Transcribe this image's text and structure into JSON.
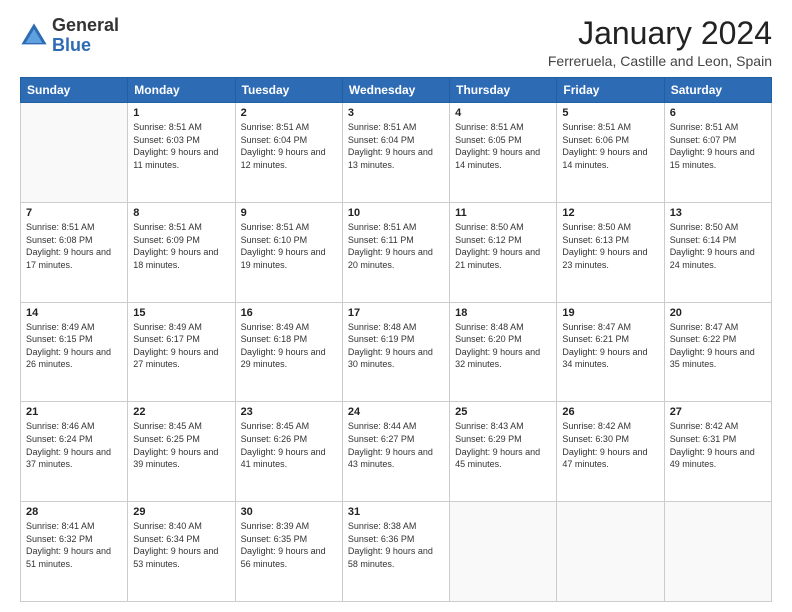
{
  "header": {
    "logo_general": "General",
    "logo_blue": "Blue",
    "month_year": "January 2024",
    "location": "Ferreruela, Castille and Leon, Spain"
  },
  "weekdays": [
    "Sunday",
    "Monday",
    "Tuesday",
    "Wednesday",
    "Thursday",
    "Friday",
    "Saturday"
  ],
  "weeks": [
    [
      {
        "day": "",
        "sunrise": "",
        "sunset": "",
        "daylight": ""
      },
      {
        "day": "1",
        "sunrise": "Sunrise: 8:51 AM",
        "sunset": "Sunset: 6:03 PM",
        "daylight": "Daylight: 9 hours and 11 minutes."
      },
      {
        "day": "2",
        "sunrise": "Sunrise: 8:51 AM",
        "sunset": "Sunset: 6:04 PM",
        "daylight": "Daylight: 9 hours and 12 minutes."
      },
      {
        "day": "3",
        "sunrise": "Sunrise: 8:51 AM",
        "sunset": "Sunset: 6:04 PM",
        "daylight": "Daylight: 9 hours and 13 minutes."
      },
      {
        "day": "4",
        "sunrise": "Sunrise: 8:51 AM",
        "sunset": "Sunset: 6:05 PM",
        "daylight": "Daylight: 9 hours and 14 minutes."
      },
      {
        "day": "5",
        "sunrise": "Sunrise: 8:51 AM",
        "sunset": "Sunset: 6:06 PM",
        "daylight": "Daylight: 9 hours and 14 minutes."
      },
      {
        "day": "6",
        "sunrise": "Sunrise: 8:51 AM",
        "sunset": "Sunset: 6:07 PM",
        "daylight": "Daylight: 9 hours and 15 minutes."
      }
    ],
    [
      {
        "day": "7",
        "sunrise": "Sunrise: 8:51 AM",
        "sunset": "Sunset: 6:08 PM",
        "daylight": "Daylight: 9 hours and 17 minutes."
      },
      {
        "day": "8",
        "sunrise": "Sunrise: 8:51 AM",
        "sunset": "Sunset: 6:09 PM",
        "daylight": "Daylight: 9 hours and 18 minutes."
      },
      {
        "day": "9",
        "sunrise": "Sunrise: 8:51 AM",
        "sunset": "Sunset: 6:10 PM",
        "daylight": "Daylight: 9 hours and 19 minutes."
      },
      {
        "day": "10",
        "sunrise": "Sunrise: 8:51 AM",
        "sunset": "Sunset: 6:11 PM",
        "daylight": "Daylight: 9 hours and 20 minutes."
      },
      {
        "day": "11",
        "sunrise": "Sunrise: 8:50 AM",
        "sunset": "Sunset: 6:12 PM",
        "daylight": "Daylight: 9 hours and 21 minutes."
      },
      {
        "day": "12",
        "sunrise": "Sunrise: 8:50 AM",
        "sunset": "Sunset: 6:13 PM",
        "daylight": "Daylight: 9 hours and 23 minutes."
      },
      {
        "day": "13",
        "sunrise": "Sunrise: 8:50 AM",
        "sunset": "Sunset: 6:14 PM",
        "daylight": "Daylight: 9 hours and 24 minutes."
      }
    ],
    [
      {
        "day": "14",
        "sunrise": "Sunrise: 8:49 AM",
        "sunset": "Sunset: 6:15 PM",
        "daylight": "Daylight: 9 hours and 26 minutes."
      },
      {
        "day": "15",
        "sunrise": "Sunrise: 8:49 AM",
        "sunset": "Sunset: 6:17 PM",
        "daylight": "Daylight: 9 hours and 27 minutes."
      },
      {
        "day": "16",
        "sunrise": "Sunrise: 8:49 AM",
        "sunset": "Sunset: 6:18 PM",
        "daylight": "Daylight: 9 hours and 29 minutes."
      },
      {
        "day": "17",
        "sunrise": "Sunrise: 8:48 AM",
        "sunset": "Sunset: 6:19 PM",
        "daylight": "Daylight: 9 hours and 30 minutes."
      },
      {
        "day": "18",
        "sunrise": "Sunrise: 8:48 AM",
        "sunset": "Sunset: 6:20 PM",
        "daylight": "Daylight: 9 hours and 32 minutes."
      },
      {
        "day": "19",
        "sunrise": "Sunrise: 8:47 AM",
        "sunset": "Sunset: 6:21 PM",
        "daylight": "Daylight: 9 hours and 34 minutes."
      },
      {
        "day": "20",
        "sunrise": "Sunrise: 8:47 AM",
        "sunset": "Sunset: 6:22 PM",
        "daylight": "Daylight: 9 hours and 35 minutes."
      }
    ],
    [
      {
        "day": "21",
        "sunrise": "Sunrise: 8:46 AM",
        "sunset": "Sunset: 6:24 PM",
        "daylight": "Daylight: 9 hours and 37 minutes."
      },
      {
        "day": "22",
        "sunrise": "Sunrise: 8:45 AM",
        "sunset": "Sunset: 6:25 PM",
        "daylight": "Daylight: 9 hours and 39 minutes."
      },
      {
        "day": "23",
        "sunrise": "Sunrise: 8:45 AM",
        "sunset": "Sunset: 6:26 PM",
        "daylight": "Daylight: 9 hours and 41 minutes."
      },
      {
        "day": "24",
        "sunrise": "Sunrise: 8:44 AM",
        "sunset": "Sunset: 6:27 PM",
        "daylight": "Daylight: 9 hours and 43 minutes."
      },
      {
        "day": "25",
        "sunrise": "Sunrise: 8:43 AM",
        "sunset": "Sunset: 6:29 PM",
        "daylight": "Daylight: 9 hours and 45 minutes."
      },
      {
        "day": "26",
        "sunrise": "Sunrise: 8:42 AM",
        "sunset": "Sunset: 6:30 PM",
        "daylight": "Daylight: 9 hours and 47 minutes."
      },
      {
        "day": "27",
        "sunrise": "Sunrise: 8:42 AM",
        "sunset": "Sunset: 6:31 PM",
        "daylight": "Daylight: 9 hours and 49 minutes."
      }
    ],
    [
      {
        "day": "28",
        "sunrise": "Sunrise: 8:41 AM",
        "sunset": "Sunset: 6:32 PM",
        "daylight": "Daylight: 9 hours and 51 minutes."
      },
      {
        "day": "29",
        "sunrise": "Sunrise: 8:40 AM",
        "sunset": "Sunset: 6:34 PM",
        "daylight": "Daylight: 9 hours and 53 minutes."
      },
      {
        "day": "30",
        "sunrise": "Sunrise: 8:39 AM",
        "sunset": "Sunset: 6:35 PM",
        "daylight": "Daylight: 9 hours and 56 minutes."
      },
      {
        "day": "31",
        "sunrise": "Sunrise: 8:38 AM",
        "sunset": "Sunset: 6:36 PM",
        "daylight": "Daylight: 9 hours and 58 minutes."
      },
      {
        "day": "",
        "sunrise": "",
        "sunset": "",
        "daylight": ""
      },
      {
        "day": "",
        "sunrise": "",
        "sunset": "",
        "daylight": ""
      },
      {
        "day": "",
        "sunrise": "",
        "sunset": "",
        "daylight": ""
      }
    ]
  ]
}
